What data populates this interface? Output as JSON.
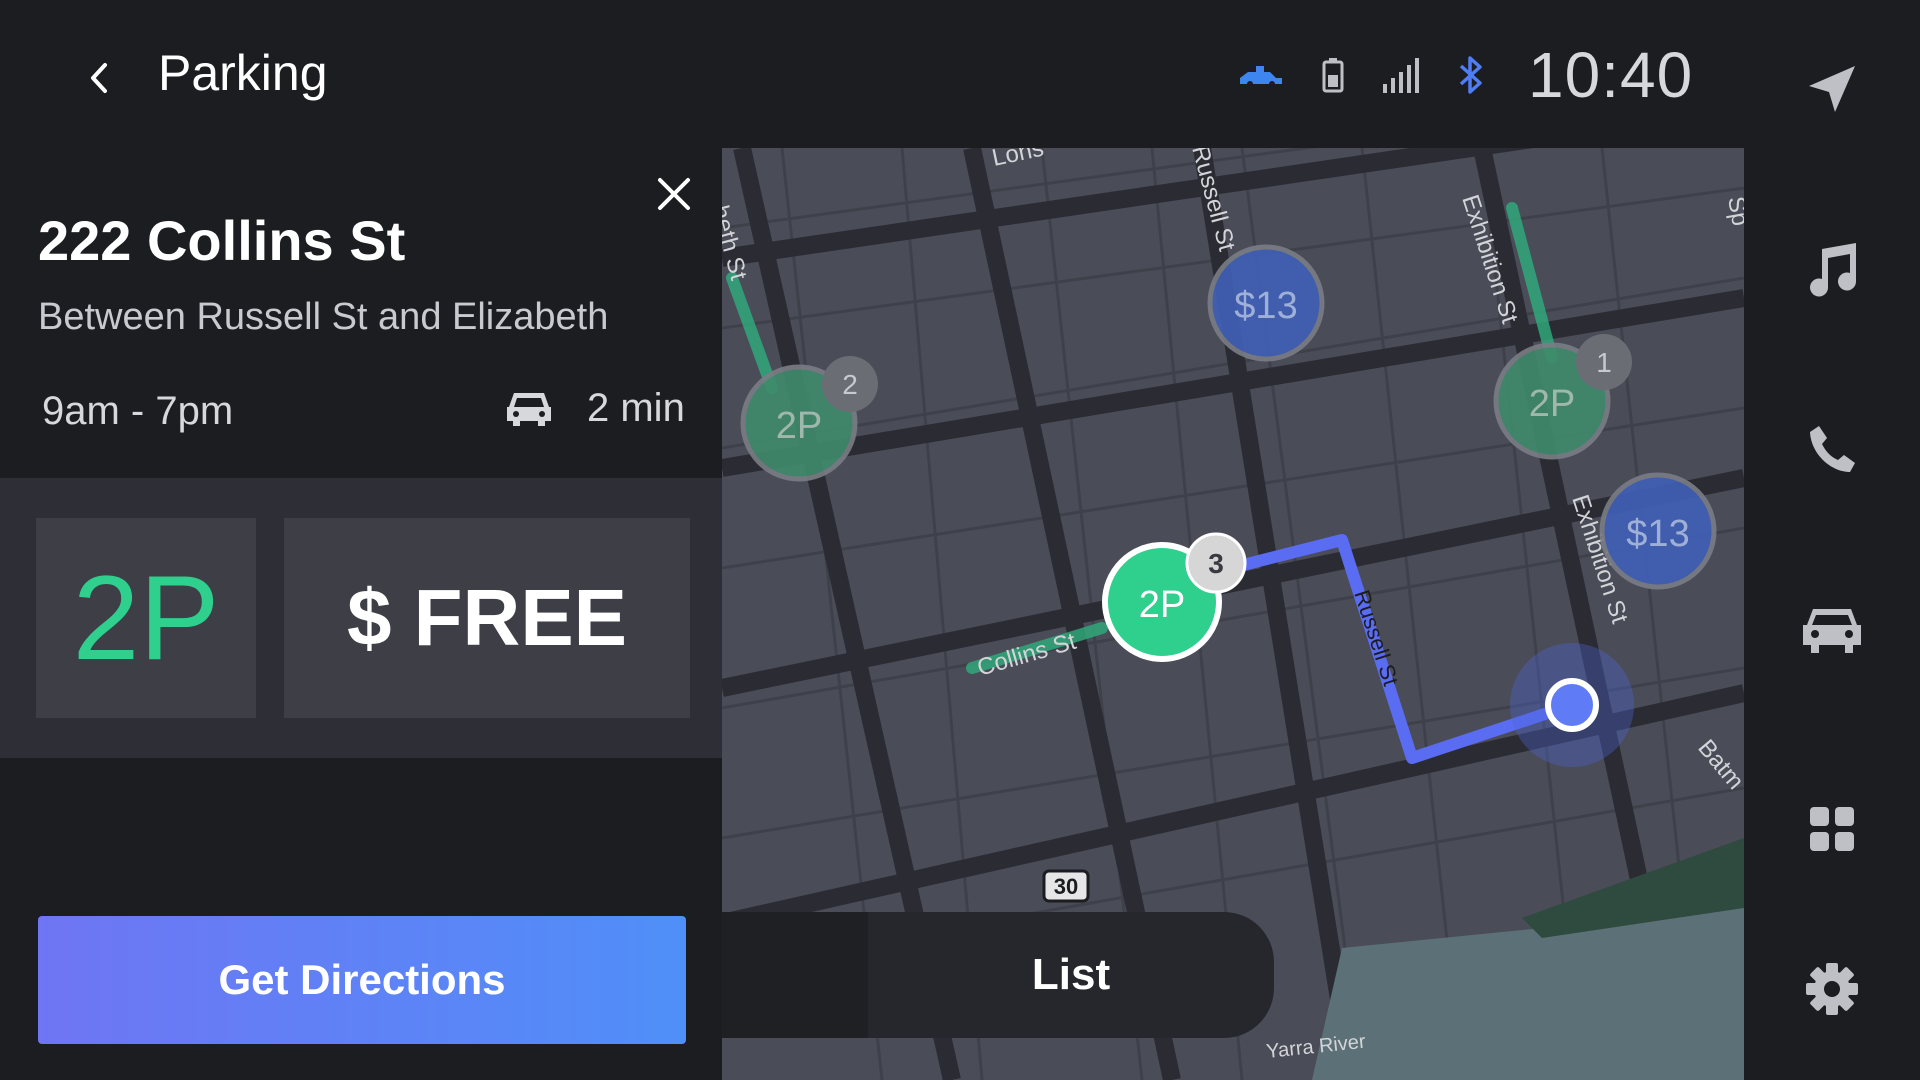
{
  "header": {
    "title": "Parking",
    "clock": "10:40"
  },
  "detail": {
    "address": "222 Collins St",
    "between": "Between Russell St and Elizabeth",
    "hours": "9am - 7pm",
    "drive_time": "2 min",
    "limit": "2P",
    "price": "$ FREE",
    "directions_label": "Get Directions"
  },
  "map": {
    "streets": [
      "Lons",
      "Russell St",
      "Exhibition St",
      "Sp",
      "heth St",
      "Collins St",
      "Exhibition St",
      "Batm",
      "Yarra River",
      "Russell St"
    ],
    "route_badge": "30",
    "markers": [
      {
        "label": "2P",
        "badge": "2",
        "type": "time",
        "selected": false
      },
      {
        "label": "$13",
        "badge": "",
        "type": "paid",
        "selected": false
      },
      {
        "label": "2P",
        "badge": "1",
        "type": "time",
        "selected": false
      },
      {
        "label": "$13",
        "badge": "",
        "type": "paid",
        "selected": false
      },
      {
        "label": "2P",
        "badge": "3",
        "type": "time",
        "selected": true
      }
    ],
    "list_label": "List"
  },
  "colors": {
    "accent_green": "#2fcf8e",
    "paid_blue": "#3f5fb8",
    "route_blue": "#5a6cf2",
    "bluetooth": "#4f7df5"
  },
  "rail": {
    "items": [
      "navigation-icon",
      "music-icon",
      "phone-icon",
      "car-icon",
      "apps-icon",
      "settings-icon"
    ]
  }
}
